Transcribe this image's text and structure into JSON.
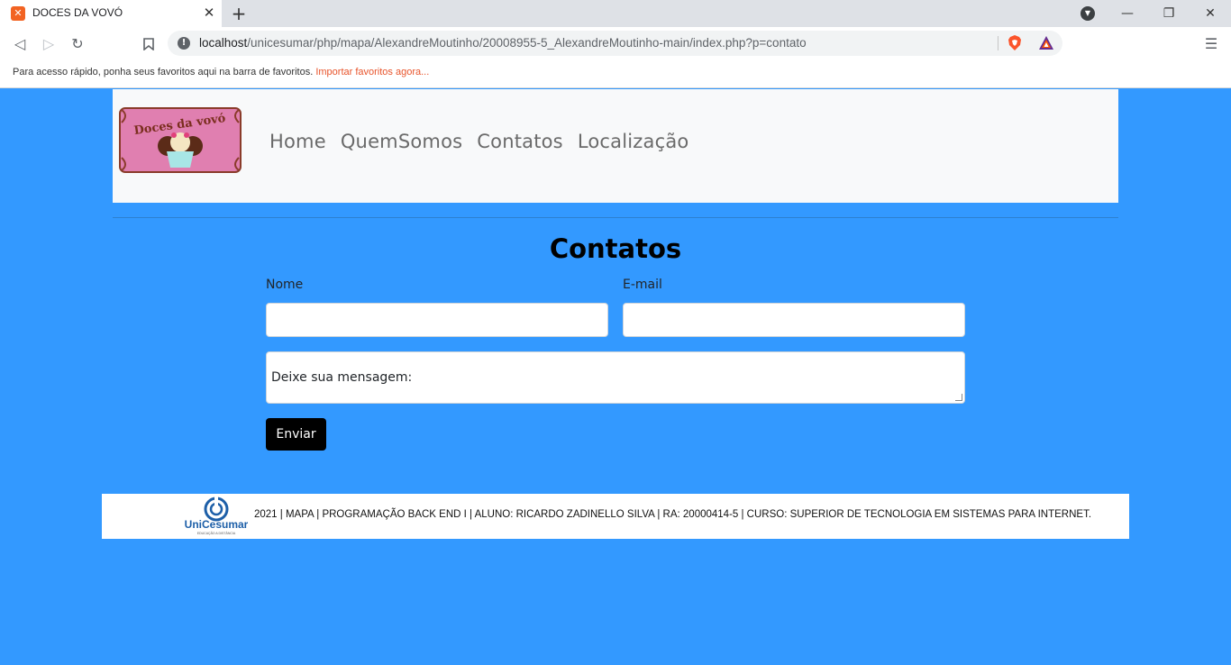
{
  "browser": {
    "tab_title": "DOCES DA VOVÓ",
    "url_host": "localhost",
    "url_path": "/unicesumar/php/mapa/AlexandreMoutinho/20008955-5_AlexandreMoutinho-main/index.php?p=contato",
    "bookmarks_text": "Para acesso rápido, ponha seus favoritos aqui na barra de favoritos.",
    "bookmarks_link": "Importar favoritos agora..."
  },
  "header": {
    "logo_text": "Doces da vovó",
    "nav": [
      "Home",
      "QuemSomos",
      "Contatos",
      "Localização"
    ]
  },
  "contact": {
    "title": "Contatos",
    "name_label": "Nome",
    "email_label": "E-mail",
    "message_placeholder": "Deixe sua mensagem:",
    "submit_label": "Enviar"
  },
  "footer": {
    "logo_text": "UniCesumar",
    "logo_subtext": "EDUCAÇÃO A DISTÂNCIA",
    "text": "2021 | MAPA | PROGRAMAÇÃO BACK END I | ALUNO: RICARDO ZADINELLO SILVA | RA: 20000414-5 | CURSO: SUPERIOR DE TECNOLOGIA EM SISTEMAS PARA INTERNET."
  },
  "colors": {
    "page_background": "#3399ff",
    "header_background": "#f8f9fa",
    "logo_pink": "#e07fb0",
    "button": "#000000"
  }
}
